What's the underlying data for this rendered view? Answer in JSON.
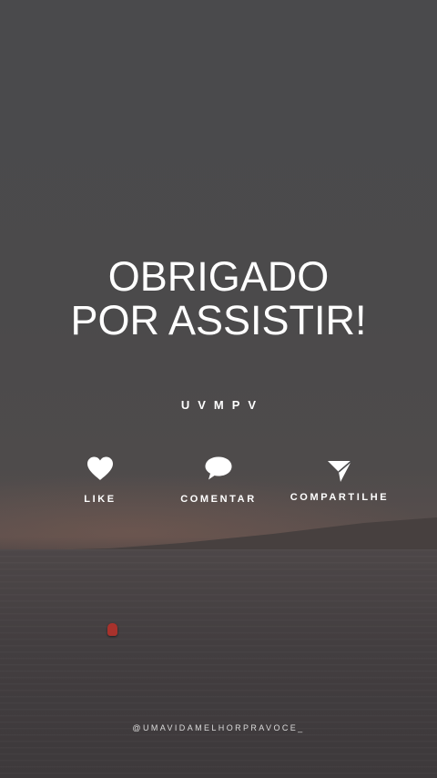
{
  "title": {
    "line1": "OBRIGADO",
    "line2": "POR ASSISTIR!"
  },
  "brand": "UVMPV",
  "actions": [
    {
      "label": "LIKE",
      "icon": "heart-icon"
    },
    {
      "label": "COMENTAR",
      "icon": "speech-bubble-icon"
    },
    {
      "label": "COMPARTILHE",
      "icon": "paper-plane-icon"
    }
  ],
  "handle": "@UMAVIDAMELHORPRAVOCE_",
  "colors": {
    "text": "#ffffff",
    "overlay": "#4a4a4c",
    "buoy": "#a8322c"
  }
}
